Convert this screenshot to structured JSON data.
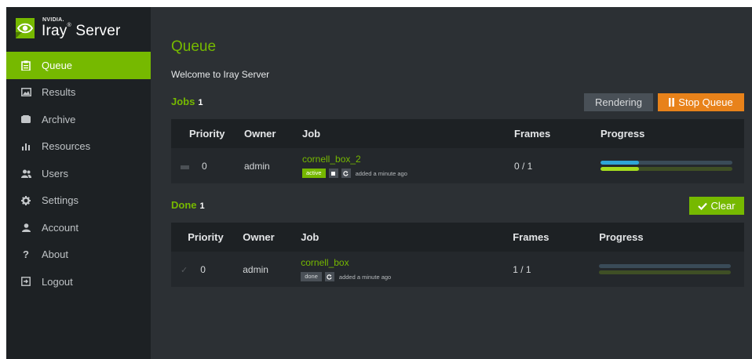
{
  "brand": {
    "vendor": "NVIDIA.",
    "product": "Iray",
    "product_suffix": "Server",
    "tm": "®"
  },
  "sidebar": {
    "items": [
      {
        "label": "Queue",
        "icon": "clipboard-icon",
        "active": true
      },
      {
        "label": "Results",
        "icon": "image-icon",
        "active": false
      },
      {
        "label": "Archive",
        "icon": "archive-icon",
        "active": false
      },
      {
        "label": "Resources",
        "icon": "bar-chart-icon",
        "active": false
      },
      {
        "label": "Users",
        "icon": "users-icon",
        "active": false
      },
      {
        "label": "Settings",
        "icon": "gear-icon",
        "active": false
      },
      {
        "label": "Account",
        "icon": "user-icon",
        "active": false
      },
      {
        "label": "About",
        "icon": "question-icon",
        "active": false
      },
      {
        "label": "Logout",
        "icon": "logout-icon",
        "active": false
      }
    ]
  },
  "main": {
    "title": "Queue",
    "welcome": "Welcome to Iray Server",
    "jobs": {
      "title": "Jobs",
      "count": "1",
      "rendering_label": "Rendering",
      "stop_label": "Stop Queue",
      "columns": {
        "priority": "Priority",
        "owner": "Owner",
        "job": "Job",
        "frames": "Frames",
        "progress": "Progress"
      },
      "rows": [
        {
          "priority": "0",
          "owner": "admin",
          "job": "cornell_box_2",
          "status": "active",
          "added": "added a minute ago",
          "frames": "0 / 1",
          "progress_primary": 0.29,
          "progress_secondary": 0.29
        }
      ]
    },
    "done": {
      "title": "Done",
      "count": "1",
      "clear_label": "Clear",
      "columns": {
        "priority": "Priority",
        "owner": "Owner",
        "job": "Job",
        "frames": "Frames",
        "progress": "Progress"
      },
      "rows": [
        {
          "priority": "0",
          "owner": "admin",
          "job": "cornell_box",
          "status": "done",
          "added": "added a minute ago",
          "frames": "1 / 1",
          "progress_primary": 0,
          "progress_secondary": 0
        }
      ]
    }
  },
  "colors": {
    "accent": "#76b900",
    "stop": "#e8821a",
    "sidebar": "#1d2124",
    "panel": "#2c3034"
  }
}
